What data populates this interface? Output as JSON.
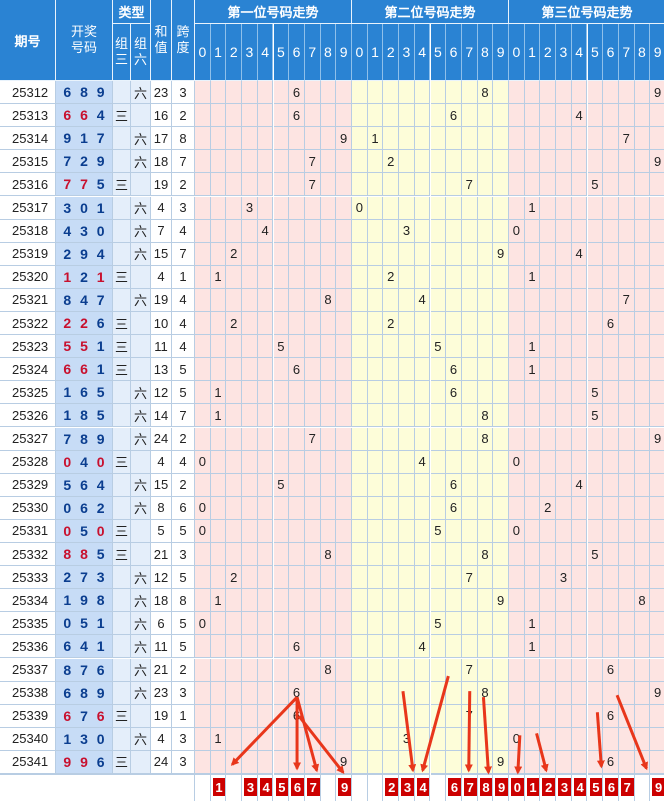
{
  "chart_data": {
    "type": "table",
    "title": "",
    "headers": {
      "issue": "期号",
      "draw": "开奖号码",
      "type": "类型",
      "type_three": "组三",
      "type_six": "组六",
      "sum": "和值",
      "span": "跨度",
      "pos1": "第一位号码走势",
      "pos2": "第二位号码走势",
      "pos3": "第三位号码走势"
    },
    "digit_labels": [
      "0",
      "1",
      "2",
      "3",
      "4",
      "5",
      "6",
      "7",
      "8",
      "9"
    ],
    "type_three_mark": "三",
    "type_six_mark": "六",
    "rows": [
      {
        "issue": "25312",
        "d": [
          6,
          8,
          9
        ],
        "type": "six",
        "sum": 23,
        "span": 3
      },
      {
        "issue": "25313",
        "d": [
          6,
          6,
          4
        ],
        "type": "three",
        "sum": 16,
        "span": 2
      },
      {
        "issue": "25314",
        "d": [
          9,
          1,
          7
        ],
        "type": "six",
        "sum": 17,
        "span": 8
      },
      {
        "issue": "25315",
        "d": [
          7,
          2,
          9
        ],
        "type": "six",
        "sum": 18,
        "span": 7
      },
      {
        "issue": "25316",
        "d": [
          7,
          7,
          5
        ],
        "type": "three",
        "sum": 19,
        "span": 2
      },
      {
        "issue": "25317",
        "d": [
          3,
          0,
          1
        ],
        "type": "six",
        "sum": 4,
        "span": 3
      },
      {
        "issue": "25318",
        "d": [
          4,
          3,
          0
        ],
        "type": "six",
        "sum": 7,
        "span": 4
      },
      {
        "issue": "25319",
        "d": [
          2,
          9,
          4
        ],
        "type": "six",
        "sum": 15,
        "span": 7
      },
      {
        "issue": "25320",
        "d": [
          1,
          2,
          1
        ],
        "type": "three",
        "sum": 4,
        "span": 1
      },
      {
        "issue": "25321",
        "d": [
          8,
          4,
          7
        ],
        "type": "six",
        "sum": 19,
        "span": 4
      },
      {
        "issue": "25322",
        "d": [
          2,
          2,
          6
        ],
        "type": "three",
        "sum": 10,
        "span": 4
      },
      {
        "issue": "25323",
        "d": [
          5,
          5,
          1
        ],
        "type": "three",
        "sum": 11,
        "span": 4
      },
      {
        "issue": "25324",
        "d": [
          6,
          6,
          1
        ],
        "type": "three",
        "sum": 13,
        "span": 5
      },
      {
        "issue": "25325",
        "d": [
          1,
          6,
          5
        ],
        "type": "six",
        "sum": 12,
        "span": 5
      },
      {
        "issue": "25326",
        "d": [
          1,
          8,
          5
        ],
        "type": "six",
        "sum": 14,
        "span": 7
      },
      {
        "issue": "25327",
        "d": [
          7,
          8,
          9
        ],
        "type": "six",
        "sum": 24,
        "span": 2
      },
      {
        "issue": "25328",
        "d": [
          0,
          4,
          0
        ],
        "type": "three",
        "sum": 4,
        "span": 4
      },
      {
        "issue": "25329",
        "d": [
          5,
          6,
          4
        ],
        "type": "six",
        "sum": 15,
        "span": 2
      },
      {
        "issue": "25330",
        "d": [
          0,
          6,
          2
        ],
        "type": "six",
        "sum": 8,
        "span": 6
      },
      {
        "issue": "25331",
        "d": [
          0,
          5,
          0
        ],
        "type": "three",
        "sum": 5,
        "span": 5
      },
      {
        "issue": "25332",
        "d": [
          8,
          8,
          5
        ],
        "type": "three",
        "sum": 21,
        "span": 3
      },
      {
        "issue": "25333",
        "d": [
          2,
          7,
          3
        ],
        "type": "six",
        "sum": 12,
        "span": 5
      },
      {
        "issue": "25334",
        "d": [
          1,
          9,
          8
        ],
        "type": "six",
        "sum": 18,
        "span": 8
      },
      {
        "issue": "25335",
        "d": [
          0,
          5,
          1
        ],
        "type": "six",
        "sum": 6,
        "span": 5
      },
      {
        "issue": "25336",
        "d": [
          6,
          4,
          1
        ],
        "type": "six",
        "sum": 11,
        "span": 5
      },
      {
        "issue": "25337",
        "d": [
          8,
          7,
          6
        ],
        "type": "six",
        "sum": 21,
        "span": 2
      },
      {
        "issue": "25338",
        "d": [
          6,
          8,
          9
        ],
        "type": "six",
        "sum": 23,
        "span": 3
      },
      {
        "issue": "25339",
        "d": [
          6,
          7,
          6
        ],
        "type": "three",
        "sum": 19,
        "span": 1
      },
      {
        "issue": "25340",
        "d": [
          1,
          3,
          0
        ],
        "type": "six",
        "sum": 4,
        "span": 3
      },
      {
        "issue": "25341",
        "d": [
          9,
          9,
          6
        ],
        "type": "three",
        "sum": 24,
        "span": 3
      }
    ],
    "forecast": {
      "pos1": [
        "1",
        "3",
        "4",
        "5",
        "6",
        "7",
        "9"
      ],
      "pos2": [
        "2",
        "3",
        "4",
        "6",
        "7",
        "8",
        "9"
      ],
      "pos3": [
        "0",
        "1",
        "2",
        "3",
        "4",
        "5",
        "6",
        "7",
        "9"
      ]
    },
    "colors": {
      "header": "#2a83d3",
      "draw_bg": "#c7dcf6",
      "pos1_bg": "#fde4e2",
      "pos2_bg": "#fdfdd9",
      "pos3_bg": "#fde4e2",
      "repeat_digit": "#c8102e",
      "digit": "#0a3d8f",
      "forecast_box": "#cc0000",
      "arrow": "#e8361b"
    }
  }
}
